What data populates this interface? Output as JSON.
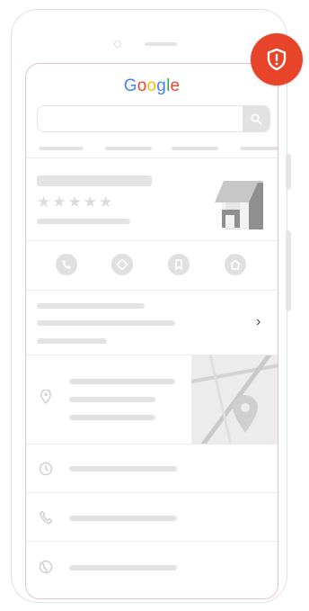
{
  "brand": {
    "logo_letters": [
      {
        "ch": "G",
        "color": "#4a80f0"
      },
      {
        "ch": "o",
        "color": "#ea4335"
      },
      {
        "ch": "o",
        "color": "#fbbc05"
      },
      {
        "ch": "g",
        "color": "#4a80f0"
      },
      {
        "ch": "l",
        "color": "#34a853"
      },
      {
        "ch": "e",
        "color": "#ea4335"
      }
    ]
  },
  "search": {
    "icon": "search-icon"
  },
  "listing": {
    "rating_stars": 5,
    "rating_glyph": "★"
  },
  "actions": [
    "phone-icon",
    "directions-icon",
    "save-icon",
    "website-icon"
  ],
  "more": {
    "chevron": "›"
  },
  "info_rows": [
    "location-pin-icon",
    "clock-icon",
    "phone-icon",
    "globe-icon"
  ],
  "security_badge": {
    "icon": "shield-alert-icon",
    "color": "#e8442a"
  },
  "colors": {
    "placeholder": "#e3e3e3",
    "screen_border": "#e8c3c6",
    "accent": "#e8442a"
  }
}
